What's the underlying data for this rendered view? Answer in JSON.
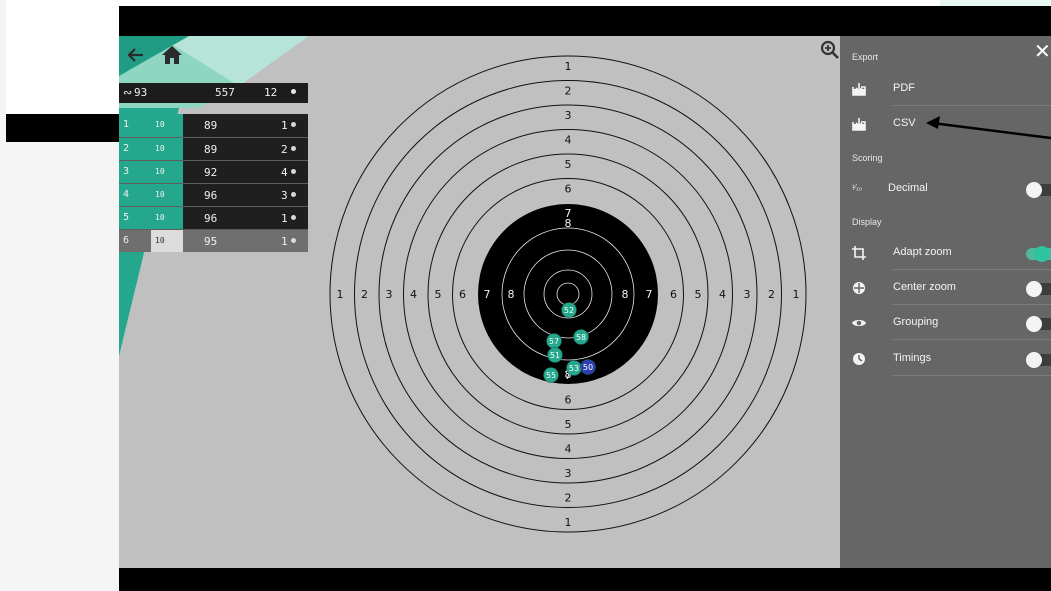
{
  "summary": {
    "prefix": "∾",
    "shots": "93",
    "total": "557",
    "inner_tens": "12"
  },
  "series": [
    {
      "index": "1",
      "count": "10",
      "score": "89",
      "tens": "1"
    },
    {
      "index": "2",
      "count": "10",
      "score": "89",
      "tens": "2"
    },
    {
      "index": "3",
      "count": "10",
      "score": "92",
      "tens": "4"
    },
    {
      "index": "4",
      "count": "10",
      "score": "96",
      "tens": "3"
    },
    {
      "index": "5",
      "count": "10",
      "score": "96",
      "tens": "1"
    },
    {
      "index": "6",
      "count": "10",
      "score": "95",
      "tens": "1"
    }
  ],
  "target": {
    "ring_labels": [
      "1",
      "2",
      "3",
      "4",
      "5",
      "6",
      "7",
      "8"
    ],
    "shots": [
      {
        "label": "52",
        "tone": "teal"
      },
      {
        "label": "58",
        "tone": "teal"
      },
      {
        "label": "57",
        "tone": "teal"
      },
      {
        "label": "51",
        "tone": "teal"
      },
      {
        "label": "55",
        "tone": "teal"
      },
      {
        "label": "53",
        "tone": "teal"
      },
      {
        "label": "50",
        "tone": "blue"
      }
    ]
  },
  "panel": {
    "export_title": "Export",
    "pdf_label": "PDF",
    "csv_label": "CSV",
    "scoring_title": "Scoring",
    "decimal_prefix": "¹⁄₁₀",
    "decimal_label": "Decimal",
    "display_title": "Display",
    "adapt_zoom_label": "Adapt zoom",
    "center_zoom_label": "Center zoom",
    "grouping_label": "Grouping",
    "timings_label": "Timings"
  },
  "toggles": {
    "decimal": false,
    "adapt_zoom": true,
    "center_zoom": false,
    "grouping": false,
    "timings": false
  },
  "colors": {
    "accent": "#24a78c",
    "panel": "#666666",
    "target_bg": "#c0c0c0",
    "shot_blue": "#2d3fb0"
  },
  "icons": {
    "back": "arrow-left-icon",
    "home": "home-icon",
    "zoom": "zoom-in-icon",
    "close": "close-icon",
    "pdf": "download-icon",
    "csv": "download-icon",
    "adapt_zoom": "crop-icon",
    "center_zoom": "crosshair-icon",
    "grouping": "eye-icon",
    "timings": "timer-icon"
  }
}
